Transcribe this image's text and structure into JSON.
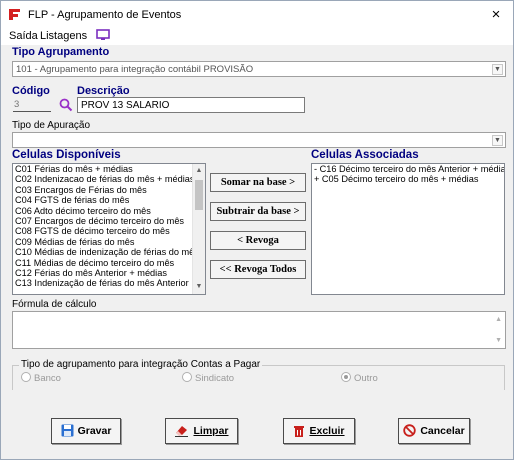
{
  "window": {
    "title": "FLP - Agrupamento de Eventos",
    "close_glyph": "×"
  },
  "menu": {
    "items": [
      {
        "label": "Saída",
        "mnemonic": "S"
      },
      {
        "label": "Listagens",
        "mnemonic": "g"
      }
    ],
    "icon": "monitor-icon"
  },
  "tipo_agrupamento": {
    "label": "Tipo Agrupamento",
    "value": "101 - Agrupamento para integração contábil PROVISÃO"
  },
  "codigo": {
    "label": "Código",
    "value": "3"
  },
  "descricao": {
    "label": "Descrição",
    "value": "PROV 13 SALARIO"
  },
  "tipo_apuracao": {
    "label": "Tipo de Apuração",
    "value": ""
  },
  "disponiveis": {
    "label": "Celulas Disponíveis",
    "items": [
      "C01 Férias do mês + médias",
      "C02 Indenizacao de férias do mês + médias",
      "C03 Encargos de Férias do mês",
      "C04 FGTS de férias do mês",
      "C06 Adto décimo terceiro do mês",
      "C07 Encargos de décimo terceiro do mês",
      "C08 FGTS de décimo terceiro do mês",
      "C09 Médias de férias do mês",
      "C10 Médias de indenização de férias do mês",
      "C11 Médias de décimo terceiro do mês",
      "C12 Férias do mês Anterior + médias",
      "C13 Indenização de férias do mês Anterior"
    ]
  },
  "associadas": {
    "label": "Celulas Associadas",
    "items": [
      "- C16 Décimo terceiro do mês Anterior + médias",
      "+ C05 Décimo terceiro do mês + médias"
    ]
  },
  "mid_buttons": {
    "somar": "Somar na base >",
    "subtrair": "Subtrair da base >",
    "revoga": "< Revoga",
    "revoga_todos": "<< Revoga Todos"
  },
  "formula": {
    "label": "Fórmula de cálculo",
    "value": ""
  },
  "integracao": {
    "label": "Tipo de agrupamento para integração Contas a Pagar",
    "options": [
      {
        "label": "Banco",
        "selected": false
      },
      {
        "label": "Sindicato",
        "selected": false
      },
      {
        "label": "Outro",
        "selected": true
      }
    ]
  },
  "buttons": {
    "gravar": "Gravar",
    "limpar": "Limpar",
    "excluir": "Excluir",
    "cancelar": "Cancelar"
  },
  "colors": {
    "label_blue": "#000080",
    "app_red": "#d42020",
    "save_blue": "#2a6fd1",
    "delete_red": "#c8201c",
    "monitor_purple": "#7b2fbf"
  }
}
